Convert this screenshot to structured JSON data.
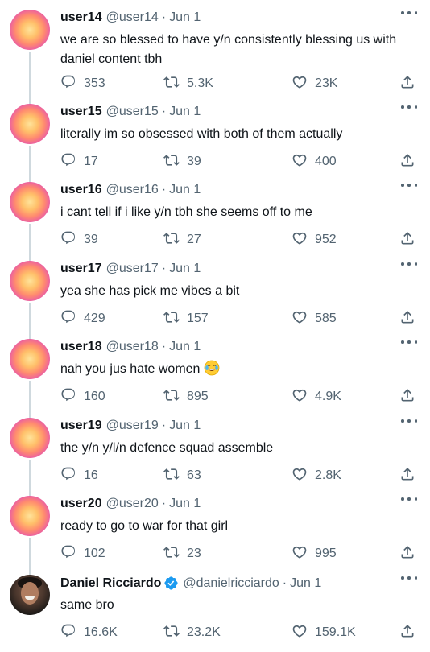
{
  "tweets": [
    {
      "name": "user14",
      "handle": "@user14",
      "time": "Jun 1",
      "text": "we are so blessed to have y/n consistently blessing us with daniel content tbh",
      "replies": "353",
      "retweets": "5.3K",
      "likes": "23K"
    },
    {
      "name": "user15",
      "handle": "@user15",
      "time": "Jun 1",
      "text": "literally im so obsessed with both of them actually",
      "replies": "17",
      "retweets": "39",
      "likes": "400"
    },
    {
      "name": "user16",
      "handle": "@user16",
      "time": "Jun 1",
      "text": "i cant tell if i like y/n tbh she seems off to me",
      "replies": "39",
      "retweets": "27",
      "likes": "952"
    },
    {
      "name": "user17",
      "handle": "@user17",
      "time": "Jun 1",
      "text": "yea she has pick me vibes a bit",
      "replies": "429",
      "retweets": "157",
      "likes": "585"
    },
    {
      "name": "user18",
      "handle": "@user18",
      "time": "Jun 1",
      "text": "nah you jus hate women",
      "emoji": "face-with-tears-of-joy",
      "replies": "160",
      "retweets": "895",
      "likes": "4.9K"
    },
    {
      "name": "user19",
      "handle": "@user19",
      "time": "Jun 1",
      "text": "the y/n y/l/n defence squad assemble",
      "replies": "16",
      "retweets": "63",
      "likes": "2.8K"
    },
    {
      "name": "user20",
      "handle": "@user20",
      "time": "Jun 1",
      "text": "ready to go to war for that girl",
      "replies": "102",
      "retweets": "23",
      "likes": "995"
    },
    {
      "name": "Daniel Ricciardo",
      "handle": "@danielricciardo",
      "time": "Jun 1",
      "verified": true,
      "text": "same bro",
      "replies": "16.6K",
      "retweets": "23.2K",
      "likes": "159.1K"
    }
  ],
  "separator": "·",
  "colors": {
    "text": "#0f1419",
    "secondary": "#536471",
    "thread_line": "#cfd9de",
    "verified": "#1d9bf0"
  },
  "icons": [
    "more-icon",
    "reply-icon",
    "retweet-icon",
    "like-icon",
    "share-icon",
    "verified-badge-icon"
  ]
}
